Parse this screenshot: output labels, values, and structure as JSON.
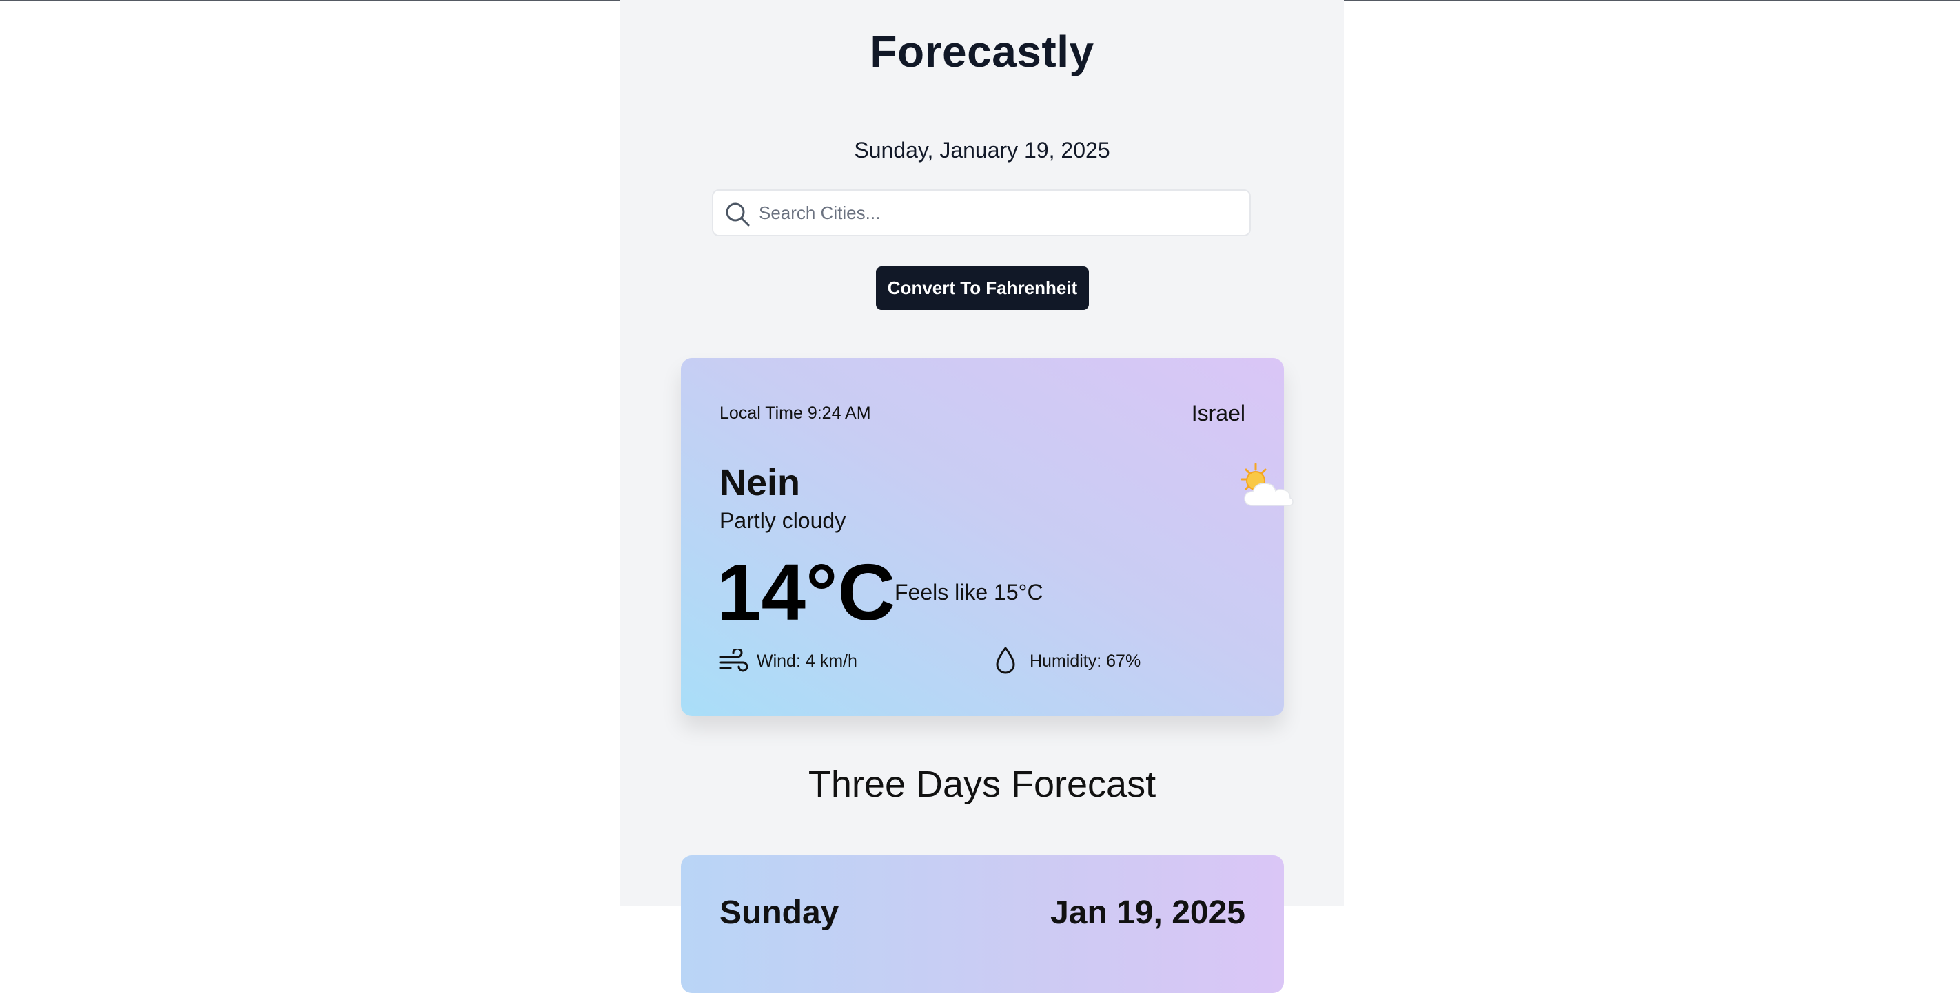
{
  "app": {
    "title": "Forecastly",
    "date": "Sunday, January 19, 2025"
  },
  "search": {
    "placeholder": "Search Cities...",
    "value": "",
    "icon": "search-icon"
  },
  "convert_button": {
    "label": "Convert To Fahrenheit",
    "background": "#111827"
  },
  "current": {
    "local_time": "Local Time 9:24 AM",
    "country": "Israel",
    "city": "Nein",
    "condition": "Partly cloudy",
    "condition_icon": "partly-cloudy-icon",
    "temperature": "14°C",
    "feels_like": "Feels like 15°C",
    "wind": "Wind: 4 km/h",
    "wind_icon": "wind-icon",
    "humidity": "Humidity: 67%",
    "humidity_icon": "droplet-icon"
  },
  "forecast": {
    "heading": "Three Days Forecast",
    "days": [
      {
        "day": "Sunday",
        "date": "Jan 19, 2025"
      }
    ]
  },
  "colors": {
    "page_background": "#f3f4f6",
    "text_dark": "#111827",
    "card_gradient_start": "#a9def8",
    "card_gradient_end": "#dac6f6"
  }
}
